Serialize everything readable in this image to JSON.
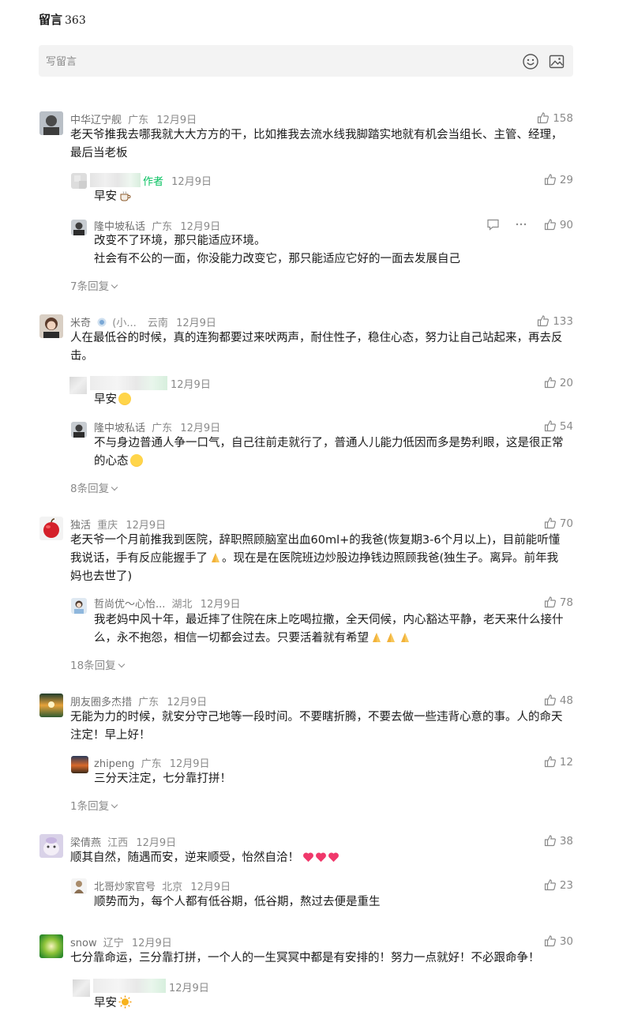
{
  "header": {
    "title": "留言",
    "count": "363"
  },
  "composer": {
    "placeholder": "写留言"
  },
  "comments": [
    {
      "name": "中华辽宁舰",
      "location": "广东",
      "date": "12月9日",
      "likes": "158",
      "text": "老天爷推我去哪我就大大方方的干，比如推我去流水线我脚踏实地就有机会当组长、主管、经理，最后当老板",
      "replies": [
        {
          "author_tag": "作者",
          "date": "12月9日",
          "likes": "29",
          "text": "早安",
          "emoji": "coffee"
        },
        {
          "name": "隆中坡私话",
          "location": "广东",
          "date": "12月9日",
          "likes": "90",
          "line1": "改变不了环境，那只能适应环境。",
          "line2": "社会有不公的一面，你没能力改变它，那只能适应它好的一面去发展自己"
        }
      ],
      "more_replies": "7条回复"
    },
    {
      "name": "米奇",
      "badge": "(小...",
      "location": "云南",
      "date": "12月9日",
      "likes": "133",
      "text": "人在最低谷的时候，真的连狗都要过来吠两声，耐住性子，稳住心态，努力让自己站起来，再去反击。",
      "replies": [
        {
          "date": "12月9日",
          "likes": "20",
          "text": "早安",
          "emoji": "hug"
        },
        {
          "name": "隆中坡私话",
          "location": "广东",
          "date": "12月9日",
          "likes": "54",
          "text": "不与身边普通人争一口气，自己往前走就行了，普通人儿能力低因而多是势利眼，这是很正常的心态",
          "emoji": "grin"
        }
      ],
      "more_replies": "8条回复"
    },
    {
      "name": "独活",
      "location": "重庆",
      "date": "12月9日",
      "likes": "70",
      "text": "老天爷一个月前推我到医院，辞职照顾脑室出血60ml+的我爸(恢复期3-6个月以上)，目前能听懂我说话，手有反应能握手了",
      "text2": "。现在是在医院班边炒股边挣钱边照顾我爸(独生子。离异。前年我妈也去世了)",
      "replies": [
        {
          "name": "哲尚优～心怡...",
          "location": "湖北",
          "date": "12月9日",
          "likes": "78",
          "text": "我老妈中风十年，最近摔了住院在床上吃喝拉撒，全天伺候，内心豁达平静，老天来什么接什么，永不抱怨，相信一切都会过去。只要活着就有希望"
        }
      ],
      "more_replies": "18条回复"
    },
    {
      "name": "朋友圈多杰措",
      "location": "广东",
      "date": "12月9日",
      "likes": "48",
      "text": "无能为力的时候，就安分守己地等一段时间。不要瞎折腾，不要去做一些违背心意的事。人的命天注定！早上好！",
      "replies": [
        {
          "name": "zhipeng",
          "location": "广东",
          "date": "12月9日",
          "likes": "12",
          "text": "三分天注定，七分靠打拼！"
        }
      ],
      "more_replies": "1条回复"
    },
    {
      "name": "梁倩燕",
      "location": "江西",
      "date": "12月9日",
      "likes": "38",
      "text": "顺其自然，随遇而安，逆来顺受，怡然自洽！",
      "replies": [
        {
          "name": "北哥炒家官号",
          "location": "北京",
          "date": "12月9日",
          "likes": "23",
          "text": "顺势而为，每个人都有低谷期，低谷期，熬过去便是重生"
        }
      ]
    },
    {
      "name": "snow",
      "location": "辽宁",
      "date": "12月9日",
      "likes": "30",
      "text": "七分靠命运，三分靠打拼，一个人的一生冥冥中都是有安排的！努力一点就好！不必跟命争！",
      "replies": [
        {
          "date": "12月9日",
          "text": "早安",
          "emoji": "sun"
        }
      ]
    }
  ],
  "colors": {
    "meta": "#8a8a8a",
    "author_tag": "#07c160",
    "input_bg": "#f3f3f3"
  }
}
